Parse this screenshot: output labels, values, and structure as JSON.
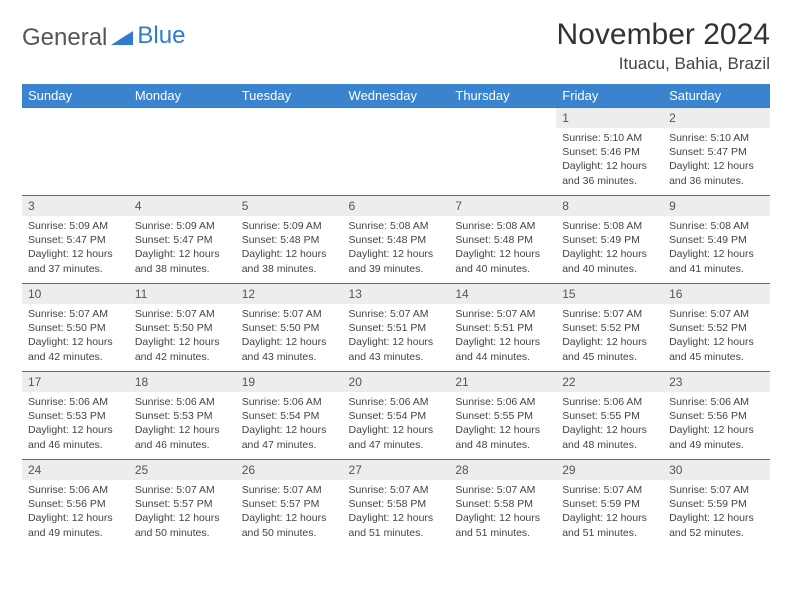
{
  "brand": {
    "part1": "General",
    "part2": "Blue"
  },
  "title": "November 2024",
  "location": "Ituacu, Bahia, Brazil",
  "dow": [
    "Sunday",
    "Monday",
    "Tuesday",
    "Wednesday",
    "Thursday",
    "Friday",
    "Saturday"
  ],
  "weeks": [
    [
      null,
      null,
      null,
      null,
      null,
      {
        "n": "1",
        "sunrise": "Sunrise: 5:10 AM",
        "sunset": "Sunset: 5:46 PM",
        "daylight": "Daylight: 12 hours and 36 minutes."
      },
      {
        "n": "2",
        "sunrise": "Sunrise: 5:10 AM",
        "sunset": "Sunset: 5:47 PM",
        "daylight": "Daylight: 12 hours and 36 minutes."
      }
    ],
    [
      {
        "n": "3",
        "sunrise": "Sunrise: 5:09 AM",
        "sunset": "Sunset: 5:47 PM",
        "daylight": "Daylight: 12 hours and 37 minutes."
      },
      {
        "n": "4",
        "sunrise": "Sunrise: 5:09 AM",
        "sunset": "Sunset: 5:47 PM",
        "daylight": "Daylight: 12 hours and 38 minutes."
      },
      {
        "n": "5",
        "sunrise": "Sunrise: 5:09 AM",
        "sunset": "Sunset: 5:48 PM",
        "daylight": "Daylight: 12 hours and 38 minutes."
      },
      {
        "n": "6",
        "sunrise": "Sunrise: 5:08 AM",
        "sunset": "Sunset: 5:48 PM",
        "daylight": "Daylight: 12 hours and 39 minutes."
      },
      {
        "n": "7",
        "sunrise": "Sunrise: 5:08 AM",
        "sunset": "Sunset: 5:48 PM",
        "daylight": "Daylight: 12 hours and 40 minutes."
      },
      {
        "n": "8",
        "sunrise": "Sunrise: 5:08 AM",
        "sunset": "Sunset: 5:49 PM",
        "daylight": "Daylight: 12 hours and 40 minutes."
      },
      {
        "n": "9",
        "sunrise": "Sunrise: 5:08 AM",
        "sunset": "Sunset: 5:49 PM",
        "daylight": "Daylight: 12 hours and 41 minutes."
      }
    ],
    [
      {
        "n": "10",
        "sunrise": "Sunrise: 5:07 AM",
        "sunset": "Sunset: 5:50 PM",
        "daylight": "Daylight: 12 hours and 42 minutes."
      },
      {
        "n": "11",
        "sunrise": "Sunrise: 5:07 AM",
        "sunset": "Sunset: 5:50 PM",
        "daylight": "Daylight: 12 hours and 42 minutes."
      },
      {
        "n": "12",
        "sunrise": "Sunrise: 5:07 AM",
        "sunset": "Sunset: 5:50 PM",
        "daylight": "Daylight: 12 hours and 43 minutes."
      },
      {
        "n": "13",
        "sunrise": "Sunrise: 5:07 AM",
        "sunset": "Sunset: 5:51 PM",
        "daylight": "Daylight: 12 hours and 43 minutes."
      },
      {
        "n": "14",
        "sunrise": "Sunrise: 5:07 AM",
        "sunset": "Sunset: 5:51 PM",
        "daylight": "Daylight: 12 hours and 44 minutes."
      },
      {
        "n": "15",
        "sunrise": "Sunrise: 5:07 AM",
        "sunset": "Sunset: 5:52 PM",
        "daylight": "Daylight: 12 hours and 45 minutes."
      },
      {
        "n": "16",
        "sunrise": "Sunrise: 5:07 AM",
        "sunset": "Sunset: 5:52 PM",
        "daylight": "Daylight: 12 hours and 45 minutes."
      }
    ],
    [
      {
        "n": "17",
        "sunrise": "Sunrise: 5:06 AM",
        "sunset": "Sunset: 5:53 PM",
        "daylight": "Daylight: 12 hours and 46 minutes."
      },
      {
        "n": "18",
        "sunrise": "Sunrise: 5:06 AM",
        "sunset": "Sunset: 5:53 PM",
        "daylight": "Daylight: 12 hours and 46 minutes."
      },
      {
        "n": "19",
        "sunrise": "Sunrise: 5:06 AM",
        "sunset": "Sunset: 5:54 PM",
        "daylight": "Daylight: 12 hours and 47 minutes."
      },
      {
        "n": "20",
        "sunrise": "Sunrise: 5:06 AM",
        "sunset": "Sunset: 5:54 PM",
        "daylight": "Daylight: 12 hours and 47 minutes."
      },
      {
        "n": "21",
        "sunrise": "Sunrise: 5:06 AM",
        "sunset": "Sunset: 5:55 PM",
        "daylight": "Daylight: 12 hours and 48 minutes."
      },
      {
        "n": "22",
        "sunrise": "Sunrise: 5:06 AM",
        "sunset": "Sunset: 5:55 PM",
        "daylight": "Daylight: 12 hours and 48 minutes."
      },
      {
        "n": "23",
        "sunrise": "Sunrise: 5:06 AM",
        "sunset": "Sunset: 5:56 PM",
        "daylight": "Daylight: 12 hours and 49 minutes."
      }
    ],
    [
      {
        "n": "24",
        "sunrise": "Sunrise: 5:06 AM",
        "sunset": "Sunset: 5:56 PM",
        "daylight": "Daylight: 12 hours and 49 minutes."
      },
      {
        "n": "25",
        "sunrise": "Sunrise: 5:07 AM",
        "sunset": "Sunset: 5:57 PM",
        "daylight": "Daylight: 12 hours and 50 minutes."
      },
      {
        "n": "26",
        "sunrise": "Sunrise: 5:07 AM",
        "sunset": "Sunset: 5:57 PM",
        "daylight": "Daylight: 12 hours and 50 minutes."
      },
      {
        "n": "27",
        "sunrise": "Sunrise: 5:07 AM",
        "sunset": "Sunset: 5:58 PM",
        "daylight": "Daylight: 12 hours and 51 minutes."
      },
      {
        "n": "28",
        "sunrise": "Sunrise: 5:07 AM",
        "sunset": "Sunset: 5:58 PM",
        "daylight": "Daylight: 12 hours and 51 minutes."
      },
      {
        "n": "29",
        "sunrise": "Sunrise: 5:07 AM",
        "sunset": "Sunset: 5:59 PM",
        "daylight": "Daylight: 12 hours and 51 minutes."
      },
      {
        "n": "30",
        "sunrise": "Sunrise: 5:07 AM",
        "sunset": "Sunset: 5:59 PM",
        "daylight": "Daylight: 12 hours and 52 minutes."
      }
    ]
  ]
}
